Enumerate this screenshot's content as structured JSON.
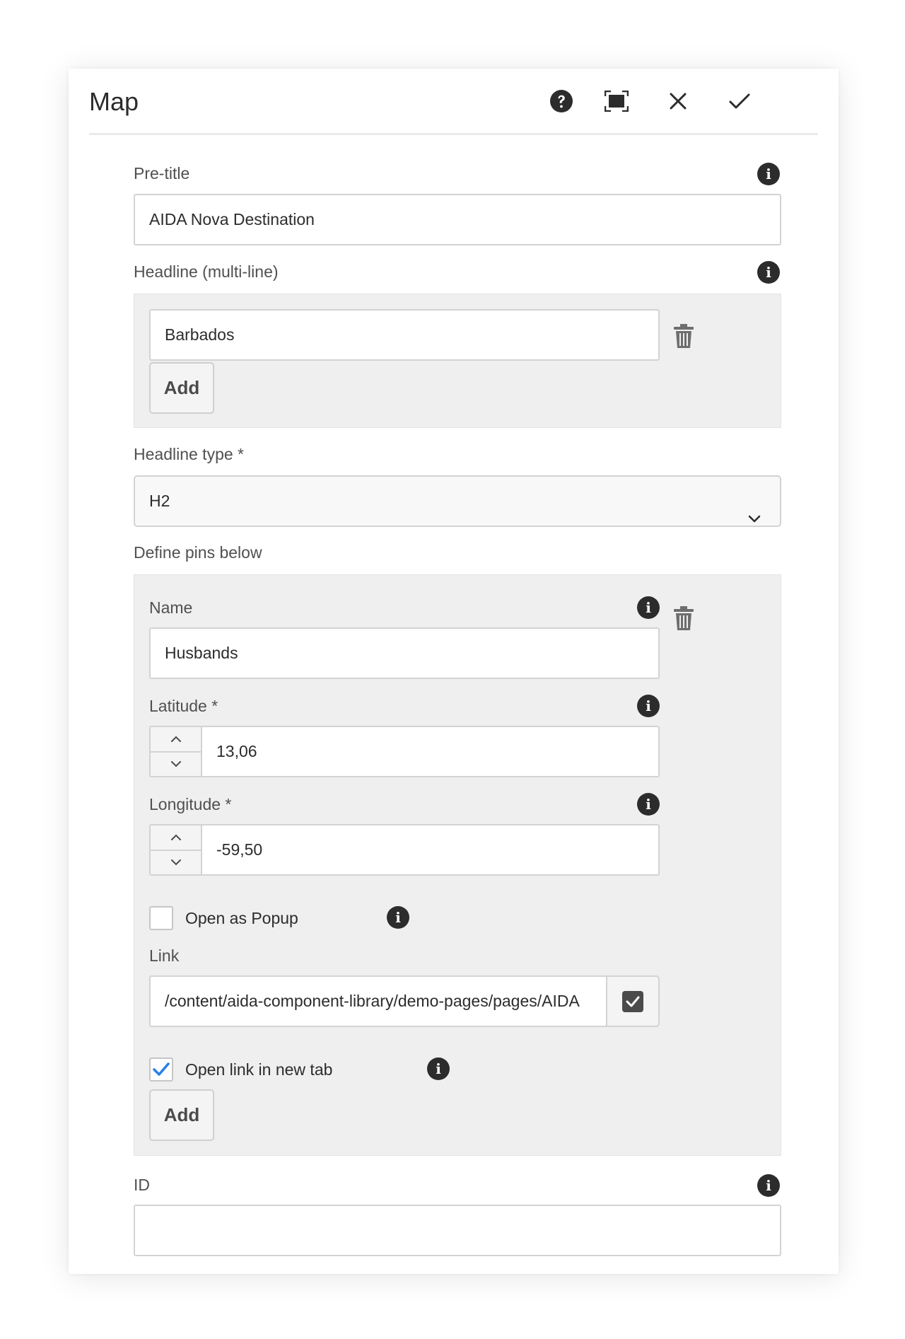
{
  "dialog": {
    "title": "Map",
    "header_icons": [
      "help-icon",
      "fullscreen-icon",
      "close-icon",
      "checkmark-icon"
    ]
  },
  "pretitle": {
    "label": "Pre-title",
    "value": "AIDA Nova Destination"
  },
  "headline": {
    "label": "Headline (multi-line)",
    "items": [
      {
        "value": "Barbados"
      }
    ],
    "add_label": "Add"
  },
  "headline_type": {
    "label": "Headline type *",
    "value": "H2"
  },
  "pins": {
    "label": "Define pins below",
    "items": [
      {
        "name_label": "Name",
        "name_value": "Husbands",
        "latitude_label": "Latitude *",
        "latitude_value": "13,06",
        "longitude_label": "Longitude *",
        "longitude_value": "-59,50",
        "popup_label": "Open as Popup",
        "popup_checked": false,
        "link_label": "Link",
        "link_value": "/content/aida-component-library/demo-pages/pages/AIDA",
        "newtab_label": "Open link in new tab",
        "newtab_checked": true
      }
    ],
    "add_label": "Add"
  },
  "id_field": {
    "label": "ID",
    "value": ""
  },
  "colors": {
    "accent": "#2680eb",
    "panel": "#efefef",
    "border": "#d3d3d3",
    "icon": "#2c2c2c"
  }
}
